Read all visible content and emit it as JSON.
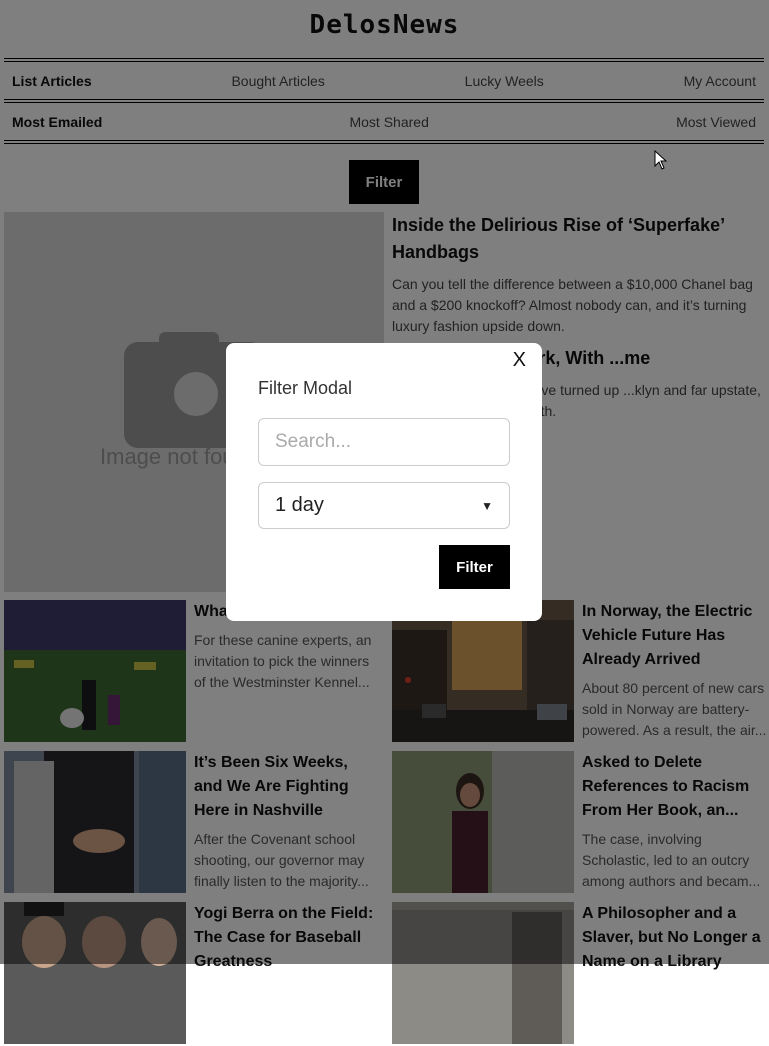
{
  "header": {
    "logo": "DelosNews"
  },
  "nav_primary": [
    {
      "label": "List Articles",
      "active": true
    },
    {
      "label": "Bought Articles",
      "active": false
    },
    {
      "label": "Lucky Weels",
      "active": false
    },
    {
      "label": "My Account",
      "active": false
    }
  ],
  "nav_secondary": [
    {
      "label": "Most Emailed",
      "active": true
    },
    {
      "label": "Most Shared",
      "active": false
    },
    {
      "label": "Most Viewed",
      "active": false
    }
  ],
  "filter_button": "Filter",
  "hero": {
    "image_text": "Image not found",
    "articles": [
      {
        "title": "Inside the Delirious Rise of ‘Superfake’ Handbags",
        "summary": "Can you tell the difference between a $10,000 Chanel bag and a $200 knockoff? Almost nobody can, and it’s turning luxury fashion upside down."
      },
      {
        "title": "...ands in New York, With ...me",
        "summary": "...th snakelike necks, have turned up ...klyn and far upstate, a sign of ...from the South."
      }
    ]
  },
  "cards": [
    {
      "title": "What ... Dog Judge",
      "summary": "For these canine experts, an invitation to pick the winners of the Westminster Kennel..."
    },
    {
      "title": "In Norway, the Electric Vehicle Future Has Already Arrived",
      "summary": "About 80 percent of new cars sold in Norway are battery-powered. As a result, the air..."
    },
    {
      "title": "It’s Been Six Weeks, and We Are Fighting Here in Nashville",
      "summary": "After the Covenant school shooting, our governor may finally listen to the majority..."
    },
    {
      "title": "Asked to Delete References to Racism From Her Book, an...",
      "summary": "The case, involving Scholastic, led to an outcry among authors and becam..."
    },
    {
      "title": "Yogi Berra on the Field: The Case for Baseball Greatness",
      "summary": ""
    },
    {
      "title": "A Philosopher and a Slaver, but No Longer a Name on a Library",
      "summary": ""
    }
  ],
  "modal": {
    "close": "X",
    "title": "Filter Modal",
    "search_placeholder": "Search...",
    "select_value": "1 day",
    "button": "Filter"
  }
}
